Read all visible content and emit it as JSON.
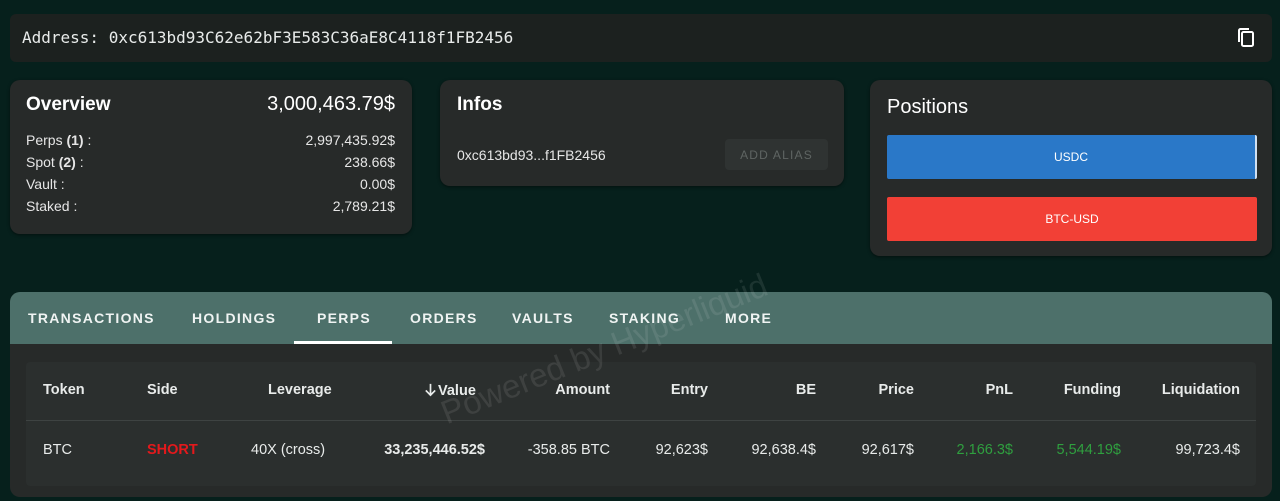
{
  "address_bar": {
    "text": "Address: 0xc613bd93C62e62bF3E583C36aE8C4118f1FB2456",
    "copy_icon": "copy-icon"
  },
  "overview": {
    "title": "Overview",
    "total": "3,000,463.79$",
    "rows": [
      {
        "label": "Perps",
        "count": "(1)",
        "suffix": " :",
        "value": "2,997,435.92$"
      },
      {
        "label": "Spot",
        "count": "(2)",
        "suffix": " :",
        "value": "238.66$"
      },
      {
        "label": "Vault",
        "count": "",
        "suffix": " :",
        "value": "0.00$"
      },
      {
        "label": "Staked",
        "count": "",
        "suffix": " :",
        "value": "2,789.21$"
      }
    ]
  },
  "infos": {
    "title": "Infos",
    "short_address": "0xc613bd93...f1FB2456",
    "add_alias_label": "ADD ALIAS"
  },
  "positions": {
    "title": "Positions",
    "bars": [
      {
        "label": "USDC",
        "color": "#2a78c8"
      },
      {
        "label": "BTC-USD",
        "color": "#f24036"
      }
    ]
  },
  "tabs": {
    "items": [
      "TRANSACTIONS",
      "HOLDINGS",
      "PERPS",
      "ORDERS",
      "VAULTS",
      "STAKING",
      "MORE"
    ],
    "active": "PERPS"
  },
  "table": {
    "headers": {
      "token": "Token",
      "side": "Side",
      "leverage": "Leverage",
      "value": "Value",
      "amount": "Amount",
      "entry": "Entry",
      "be": "BE",
      "price": "Price",
      "pnl": "PnL",
      "funding": "Funding",
      "liquidation": "Liquidation"
    },
    "sort_icon": "arrow-down-icon",
    "rows": [
      {
        "token": "BTC",
        "side": "SHORT",
        "leverage": "40X (cross)",
        "value": "33,235,446.52$",
        "amount": "-358.85 BTC",
        "entry": "92,623$",
        "be": "92,638.4$",
        "price": "92,617$",
        "pnl": "2,166.3$",
        "funding": "5,544.19$",
        "liquidation": "99,723.4$"
      }
    ]
  },
  "watermark": "Powered by Hyperliquid",
  "colors": {
    "background": "#06201c",
    "card": "#272a29",
    "tab_bar": "#4d706a",
    "short": "#e3191c",
    "positive": "#2f9f3f"
  }
}
